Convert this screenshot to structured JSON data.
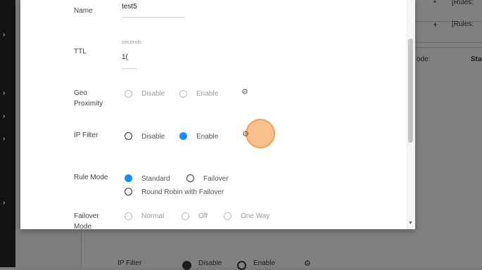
{
  "form": {
    "name_label": "Name",
    "name_value": "test5",
    "ttl_label": "TTL",
    "ttl_hint": "seconds",
    "ttl_value": "1(",
    "geo_label_line1": "Geo",
    "geo_label_line2": "Proximity",
    "geo_options": [
      "Disable",
      "Enable"
    ],
    "ipfilter_label": "IP Filter",
    "ipfilter_options": [
      "Disable",
      "Enable"
    ],
    "rulemode_label": "Rule Mode",
    "rulemode_options": [
      "Standard",
      "Failover",
      "Round Robin with Failover"
    ],
    "failover_label_line1": "Failover",
    "failover_label_line2": "Mode",
    "failover_options": [
      "Normal",
      "Off",
      "One Way"
    ]
  },
  "background": {
    "rules_1": "[Rules:",
    "rules_2": "[Rules:",
    "plus": "+",
    "col_ode": "ode:",
    "col_sta": "Sta",
    "ipfilter_label": "IP Filter",
    "disable": "Disable",
    "enable": "Enable"
  },
  "icons": {
    "gear": "gear-icon",
    "scroll_down": "arrow-down-icon",
    "nav_chevron": "chevron-right-icon"
  },
  "colors": {
    "accent_blue": "#1a8cff",
    "highlight_orange": "#f9c08f"
  }
}
